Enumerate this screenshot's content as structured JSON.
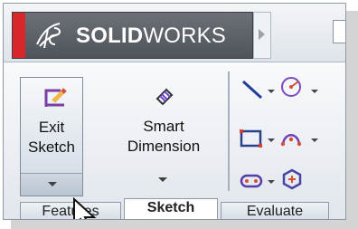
{
  "app": {
    "brand_prefix": "SOLID",
    "brand_suffix": "WORKS"
  },
  "ribbon": {
    "exit_sketch": {
      "line1": "Exit",
      "line2": "Sketch"
    },
    "smart_dimension": {
      "line1": "Smart",
      "line2": "Dimension"
    },
    "tools": [
      "line-icon",
      "circle-icon",
      "rectangle-icon",
      "arc-icon",
      "slot-icon",
      "polygon-icon"
    ]
  },
  "tabs": [
    {
      "label": "Features"
    },
    {
      "label": "Sketch"
    },
    {
      "label": "Evaluate"
    }
  ]
}
